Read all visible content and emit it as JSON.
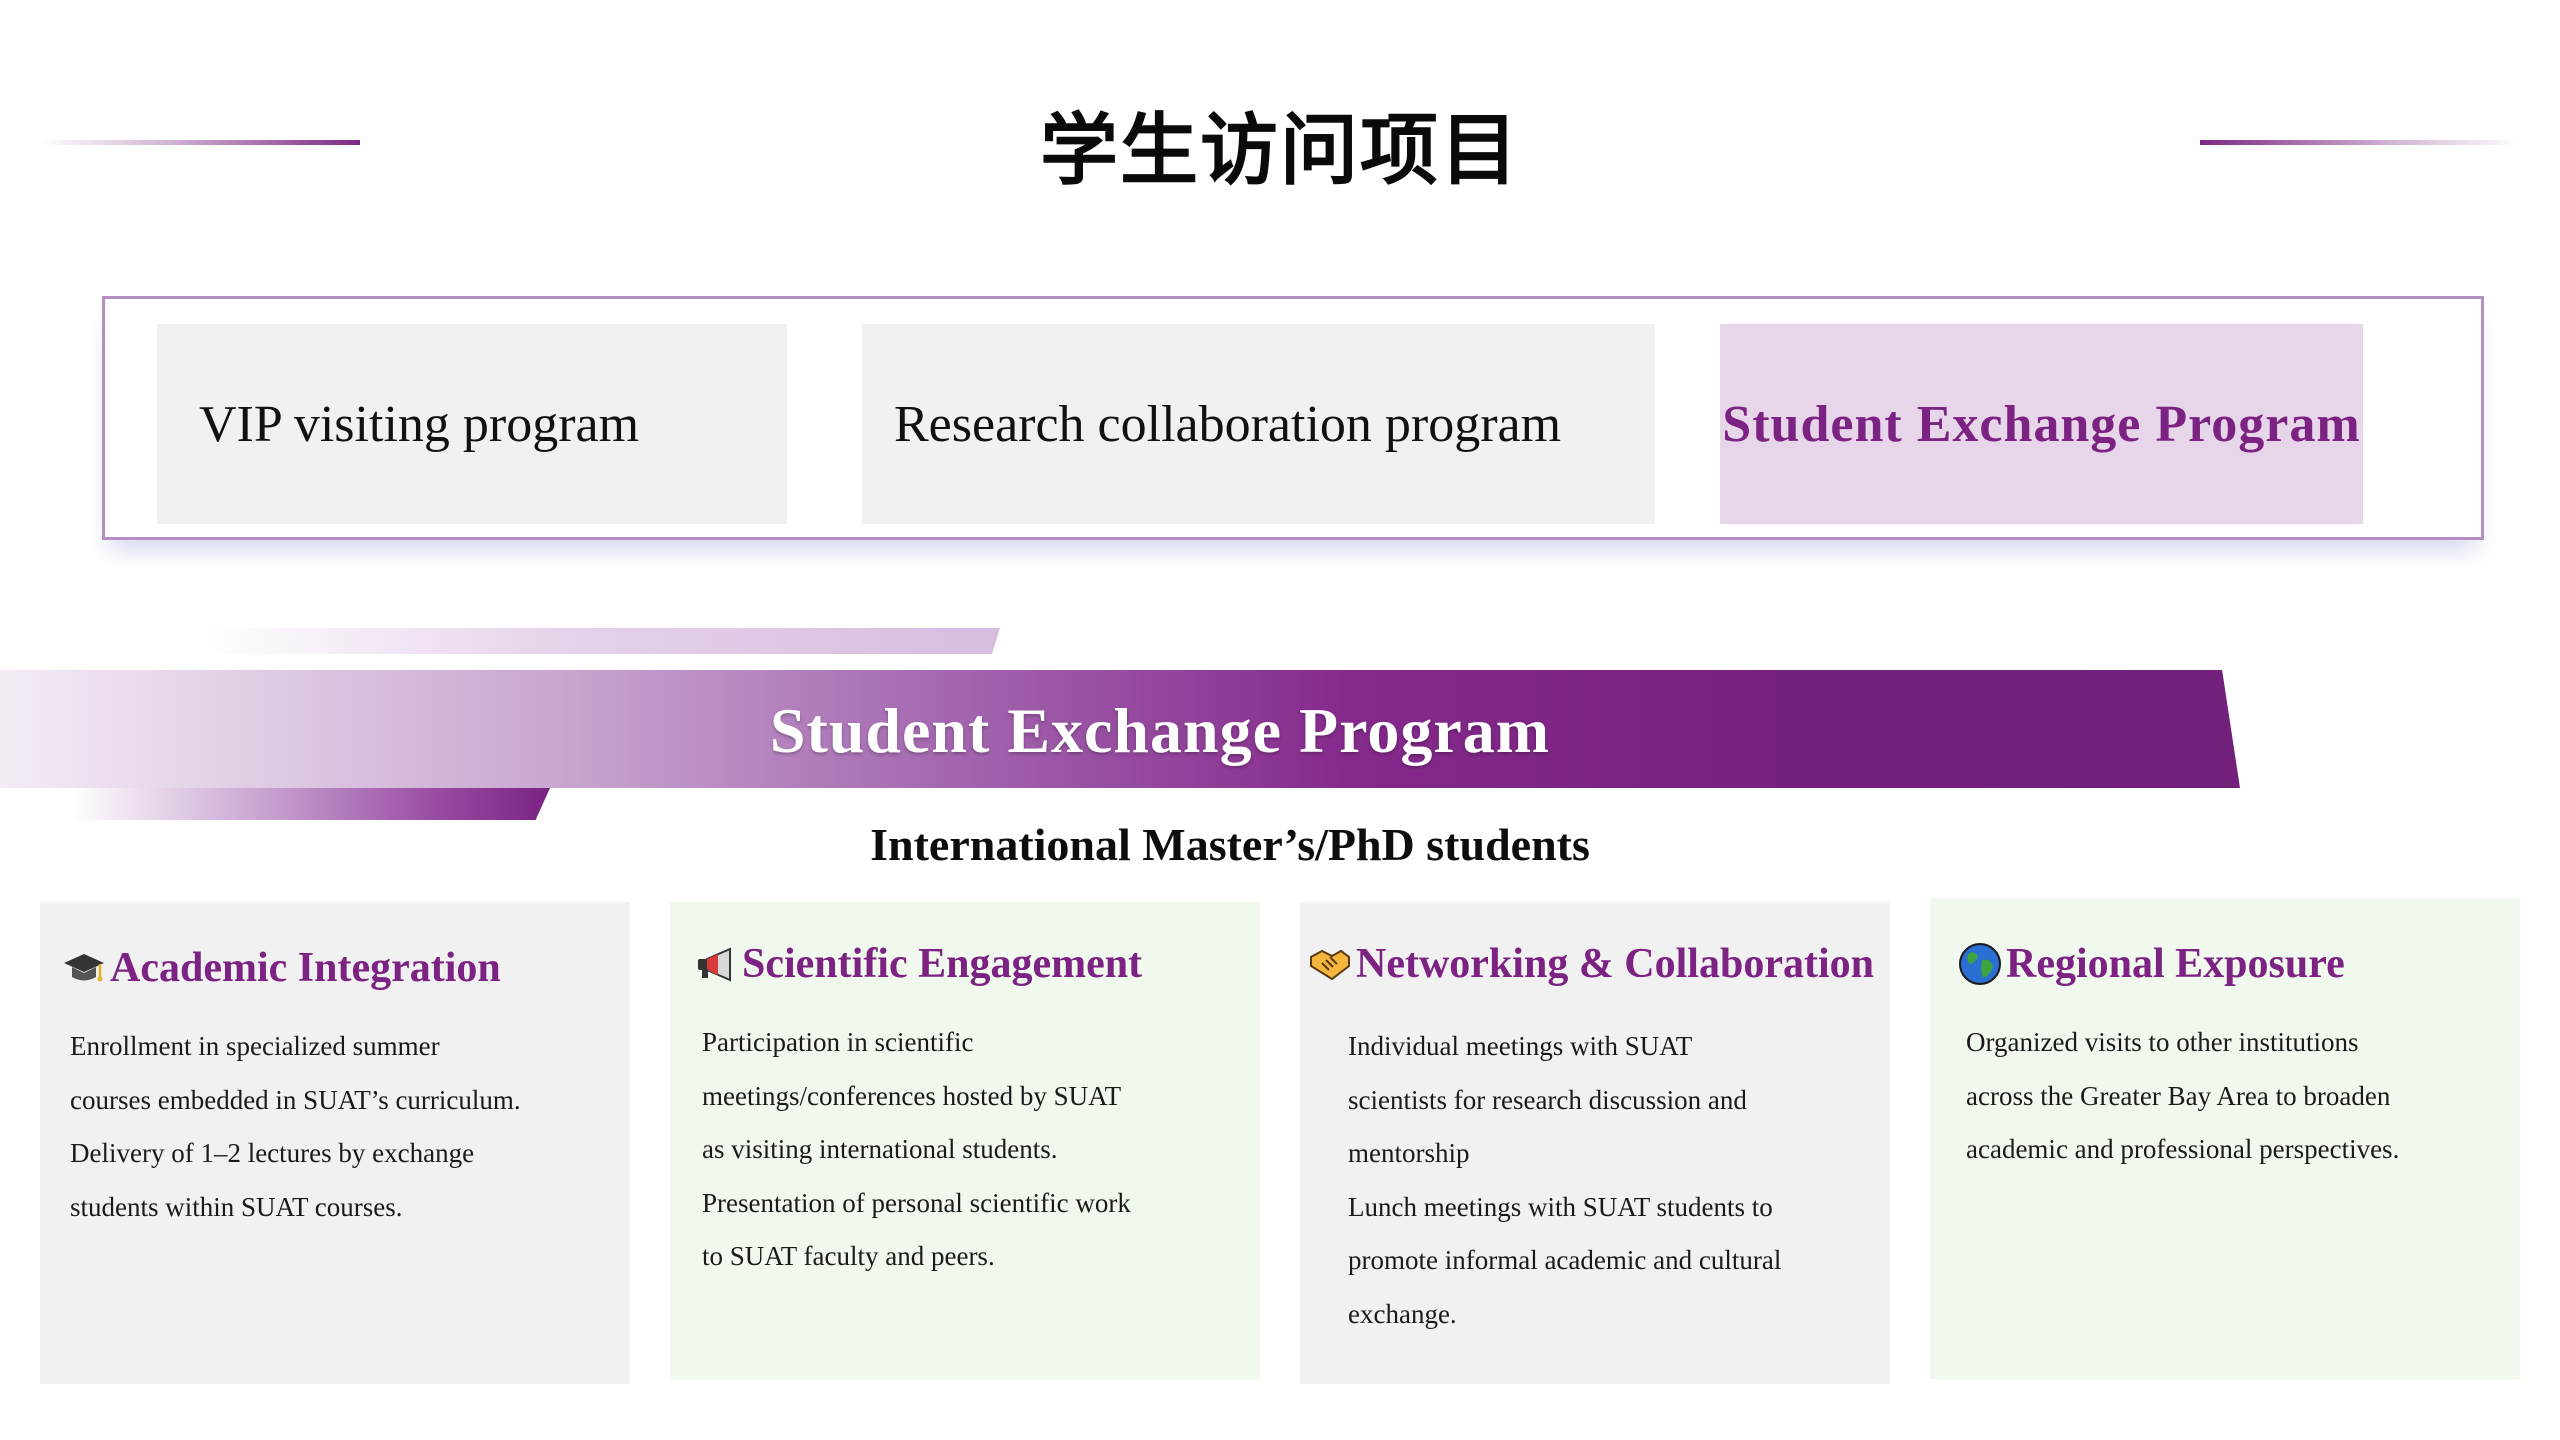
{
  "header": {
    "title": "学生访问项目"
  },
  "tabs": [
    {
      "label": "VIP visiting program",
      "active": false
    },
    {
      "label": "Research collaboration program",
      "active": false
    },
    {
      "label": "Student Exchange Program",
      "active": true
    }
  ],
  "banner": {
    "title": "Student Exchange Program",
    "subtitle": "International Master’s/PhD students"
  },
  "cards": [
    {
      "icon": "graduation-cap-icon",
      "title": "Academic Integration",
      "lines": [
        "Enrollment in specialized summer",
        "courses embedded in SUAT’s curriculum.",
        "Delivery of 1–2  lectures by exchange",
        "students within SUAT courses."
      ]
    },
    {
      "icon": "megaphone-icon",
      "title": "Scientific Engagement",
      "lines": [
        "Participation in scientific",
        "meetings/conferences hosted by SUAT",
        "as visiting international students.",
        "Presentation of personal scientific work",
        "to SUAT faculty and peers."
      ]
    },
    {
      "icon": "handshake-icon",
      "title": "Networking & Collaboration",
      "lines": [
        "Individual meetings with SUAT",
        "scientists for research discussion and",
        "mentorship",
        "Lunch meetings with SUAT students to",
        "promote informal academic and cultural",
        "exchange."
      ]
    },
    {
      "icon": "globe-icon",
      "title": "Regional Exposure",
      "lines": [
        "Organized visits to other institutions",
        "across the Greater Bay Area to broaden",
        "academic and professional perspectives."
      ]
    }
  ],
  "colors": {
    "accent": "#7b2283",
    "tab_active_bg": "#e7d5e9",
    "tab_bg": "#f1f1f1",
    "card_green_bg": "#f1f8ee",
    "frame_border": "#b68fc2"
  }
}
